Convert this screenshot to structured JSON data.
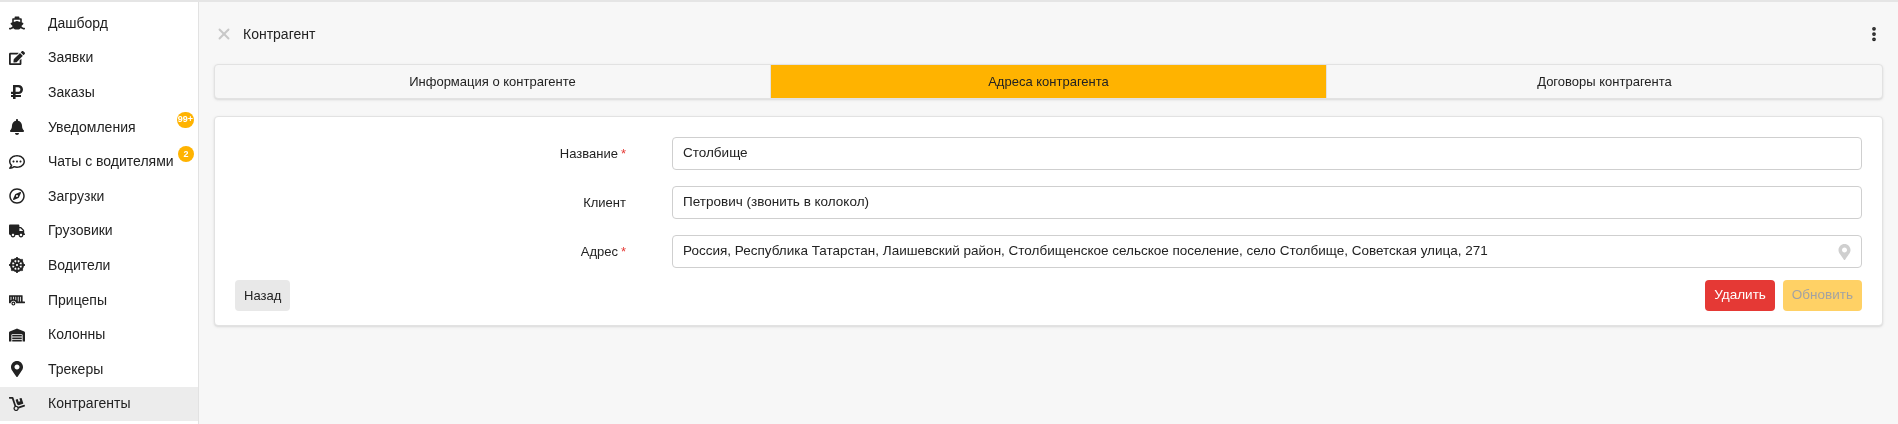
{
  "sidebar": {
    "items": [
      {
        "label": "Дашборд",
        "selected": false
      },
      {
        "label": "Заявки",
        "selected": false
      },
      {
        "label": "Заказы",
        "selected": false
      },
      {
        "label": "Уведомления",
        "selected": false,
        "badge": "99+"
      },
      {
        "label": "Чаты с водителями",
        "selected": false,
        "badge": "2"
      },
      {
        "label": "Загрузки",
        "selected": false
      },
      {
        "label": "Грузовики",
        "selected": false
      },
      {
        "label": "Водители",
        "selected": false
      },
      {
        "label": "Прицепы",
        "selected": false
      },
      {
        "label": "Колонны",
        "selected": false
      },
      {
        "label": "Трекеры",
        "selected": false
      },
      {
        "label": "Контрагенты",
        "selected": true
      }
    ]
  },
  "header": {
    "title": "Контрагент"
  },
  "tabs": [
    {
      "label": "Информация о контрагенте",
      "selected": false
    },
    {
      "label": "Адреса контрагента",
      "selected": true
    },
    {
      "label": "Договоры контрагента",
      "selected": false
    }
  ],
  "form": {
    "fields": [
      {
        "label": "Название",
        "required_mark": "*",
        "value": "Столбище"
      },
      {
        "label": "Клиент",
        "value": "Петрович (звонить в колокол)"
      },
      {
        "label": "Адрес",
        "required_mark": "*",
        "value": "Россия, Республика Татарстан, Лаишевский район, Столбищенское сельское поселение, село Столбище, Советская улица, 271",
        "kind": "location"
      }
    ],
    "back_button": "Назад",
    "buttons": [
      {
        "label": "Удалить",
        "kind": "danger",
        "disabled": false
      },
      {
        "label": "Обновить",
        "kind": "primary",
        "disabled": true
      }
    ]
  }
}
